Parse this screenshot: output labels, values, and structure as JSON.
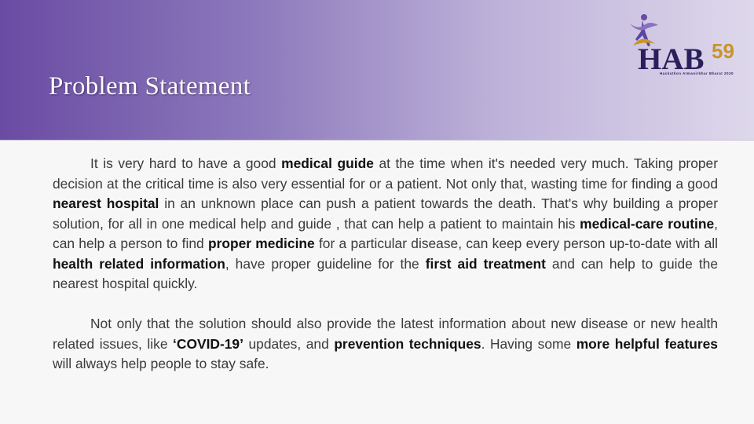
{
  "slide": {
    "title": "Problem Statement",
    "logo": {
      "text": "HAB",
      "number": "59",
      "tagline": "Hackathon  Atmanirbhar  Bharat  2020"
    },
    "colors": {
      "header_start": "#6a4ba3",
      "header_end": "#ded8ec",
      "logo_navy": "#2a1f5c",
      "logo_gold": "#c7952a",
      "logo_purple": "#6a4ba3"
    },
    "paragraph1": {
      "s1": "It is very hard to have a good ",
      "b1": "medical guide",
      "s2": " at the time when it's needed very much. Taking proper decision at the critical time is also very essential for or a patient. Not only that, wasting time for finding a good ",
      "b2": "nearest hospital",
      "s3": " in an unknown place can push a patient towards the death. That's why building a proper solution, for all in one medical help and guide , that can help a patient to maintain his ",
      "b3": "medical-care routine",
      "s4": ", can help a person to find ",
      "b4": "proper medicine",
      "s5": " for a particular disease, can keep every person up-to-date with all ",
      "b5": "health related information",
      "s6": ", have proper guideline for the ",
      "b6": "first aid treatment",
      "s7": " and can help to guide the nearest hospital quickly."
    },
    "paragraph2": {
      "s1": "Not only that the solution should also provide the latest information about new disease or new health related issues, like ",
      "b1": "‘COVID-19’",
      "s2": " updates, and ",
      "b2": "prevention techniques",
      "s3": ". Having some ",
      "b3": "more helpful features",
      "s4": " will always help people to stay safe."
    }
  }
}
